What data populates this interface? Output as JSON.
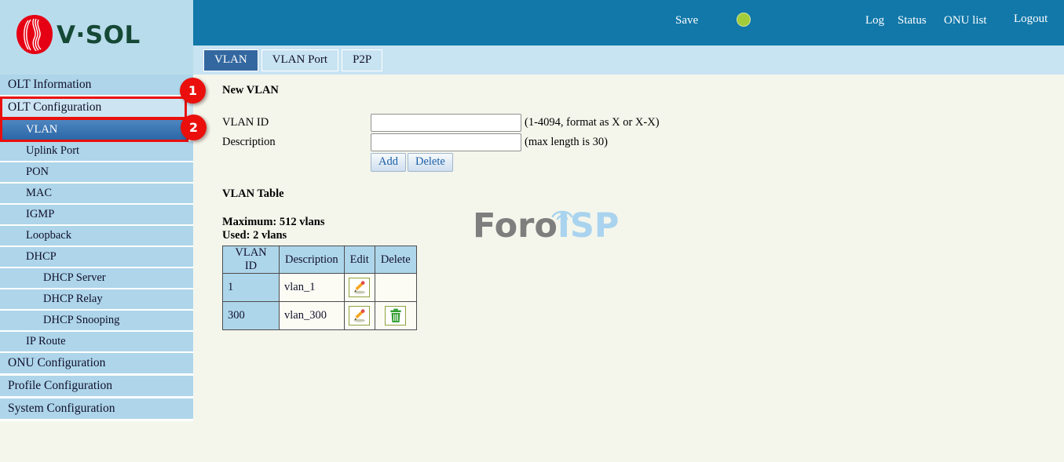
{
  "brand": {
    "logo_text": "V·SOL"
  },
  "topbar": {
    "save_label": "Save",
    "log_label": "Log",
    "status_label": "Status",
    "onu_list_label": "ONU list",
    "logout_label": "Logout",
    "status_dot_color": "#a2cc3a"
  },
  "tabs": [
    {
      "label": "VLAN",
      "active": true
    },
    {
      "label": "VLAN Port",
      "active": false
    },
    {
      "label": "P2P",
      "active": false
    }
  ],
  "sidebar": {
    "items": [
      {
        "label": "OLT Information",
        "level": 1
      },
      {
        "label": "OLT Configuration",
        "level": 1,
        "expanded": true
      },
      {
        "label": "VLAN",
        "level": 2,
        "selected": true
      },
      {
        "label": "Uplink Port",
        "level": 2
      },
      {
        "label": "PON",
        "level": 2
      },
      {
        "label": "MAC",
        "level": 2
      },
      {
        "label": "IGMP",
        "level": 2
      },
      {
        "label": "Loopback",
        "level": 2
      },
      {
        "label": "DHCP",
        "level": 2
      },
      {
        "label": "DHCP Server",
        "level": 3
      },
      {
        "label": "DHCP Relay",
        "level": 3
      },
      {
        "label": "DHCP Snooping",
        "level": 3
      },
      {
        "label": "IP Route",
        "level": 2
      },
      {
        "label": "ONU Configuration",
        "level": 1
      },
      {
        "label": "Profile Configuration",
        "level": 1
      },
      {
        "label": "System Configuration",
        "level": 1
      }
    ]
  },
  "annotations": {
    "step1": "1",
    "step2": "2",
    "color": "#ea0f0c"
  },
  "main": {
    "section_title": "New VLAN",
    "form": {
      "vlan_id": {
        "label": "VLAN ID",
        "value": "",
        "hint": "(1-4094, format as X or X-X)"
      },
      "description": {
        "label": "Description",
        "value": "",
        "hint": "(max length is 30)"
      },
      "add_label": "Add",
      "delete_label": "Delete"
    },
    "table_section": {
      "title": "VLAN Table",
      "maximum_label": "Maximum: 512 vlans",
      "used_label": "Used: 2 vlans",
      "table": {
        "headers": [
          "VLAN ID",
          "Description",
          "Edit",
          "Delete"
        ],
        "rows": [
          {
            "vlan_id": "1",
            "description": "vlan_1",
            "has_edit": true,
            "has_delete": false
          },
          {
            "vlan_id": "300",
            "description": "vlan_300",
            "has_edit": true,
            "has_delete": true
          }
        ]
      }
    },
    "watermark": {
      "part_gray": "Foro",
      "part_blue": "ISP"
    }
  }
}
